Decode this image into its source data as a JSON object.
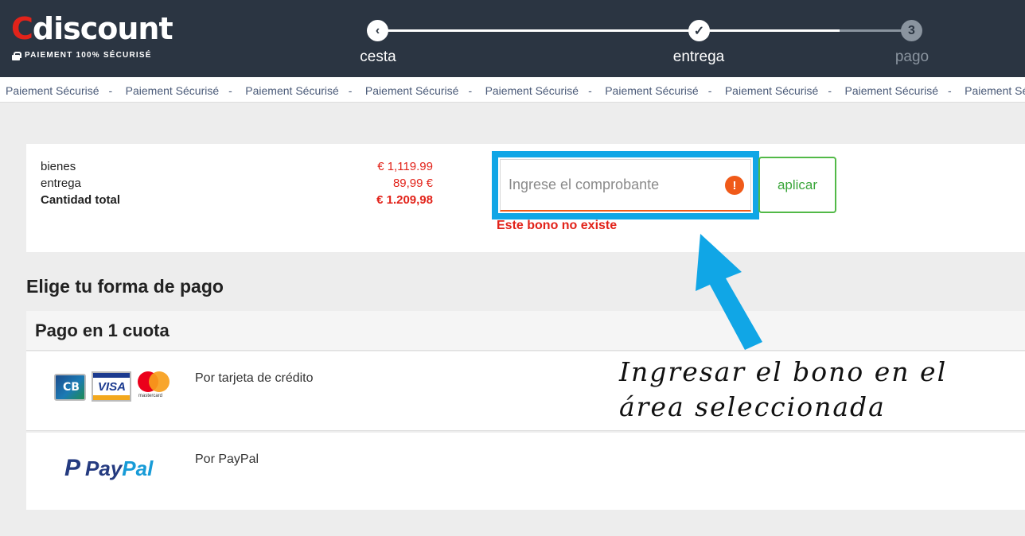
{
  "header": {
    "logo_c": "C",
    "logo_rest": "discount",
    "secure_text": "PAIEMENT 100% SÉCURISÉ",
    "steps": [
      {
        "label": "cesta",
        "icon": "‹"
      },
      {
        "label": "entrega",
        "icon": "✓"
      },
      {
        "label": "pago",
        "icon": "3"
      }
    ]
  },
  "strip": {
    "items": [
      "Paiement Sécurisé",
      "Paiement Sécurisé",
      "Paiement Sécurisé",
      "Paiement Sécurisé",
      "Paiement Sécurisé",
      "Paiement Sécurisé",
      "Paiement Sécurisé",
      "Paiement Sécurisé",
      "Paiement Sécurisé"
    ],
    "separator": "-"
  },
  "summary": {
    "goods_label": "bienes",
    "goods_value": "€ 1,119.99",
    "delivery_label": "entrega",
    "delivery_value": "89,99 €",
    "total_label": "Cantidad total",
    "total_value": "€ 1.209,98"
  },
  "voucher": {
    "placeholder": "Ingrese el comprobante",
    "warning_icon": "!",
    "apply_label": "aplicar",
    "error": "Este bono no existe"
  },
  "payment": {
    "title": "Elige tu forma de pago",
    "section": "Pago en 1 cuota",
    "methods": [
      {
        "label": "Por tarjeta de crédito"
      },
      {
        "label": "Por PayPal"
      }
    ],
    "visa_text": "VISA",
    "mastercard_text": "mastercard",
    "paypal_pay": "Pay",
    "paypal_pal": "Pal"
  },
  "annotation": {
    "line1": "Ingresar el bono en el",
    "line2": "área seleccionada",
    "arrow_color": "#10a6e6"
  },
  "colors": {
    "header_bg": "#2b3542",
    "brand_red": "#e2231a",
    "highlight_blue": "#10a6e6",
    "apply_green": "#52b947",
    "warning_orange": "#f05a19"
  }
}
